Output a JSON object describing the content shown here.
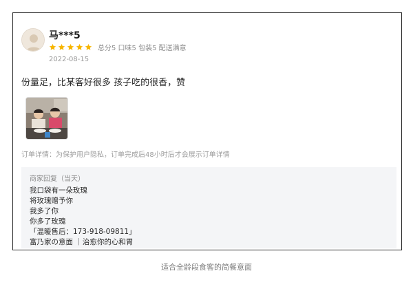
{
  "review": {
    "username": "马***5",
    "stars": 5,
    "star_color": "#f7b500",
    "ratings_text": "总分5   口味5   包装5   配送满意",
    "date": "2022-08-15",
    "text": "份量足，比某客好很多 孩子吃的很香，赞",
    "photo_icon": "children-eating-photo",
    "order_detail": "订单详情：为保护用户隐私，订单完成后48小时后才会展示订单详情"
  },
  "merchant_reply": {
    "label": "商家回复（当天）",
    "lines": [
      "我口袋有一朵玫瑰",
      "将玫瑰赠予你",
      "我多了你",
      "你多了玫瑰",
      "「温暖售后：173-918-09811」",
      "富乃家の意面 ｜治愈你的心和胃"
    ]
  },
  "caption": "适合全龄段食客的简餐意面"
}
